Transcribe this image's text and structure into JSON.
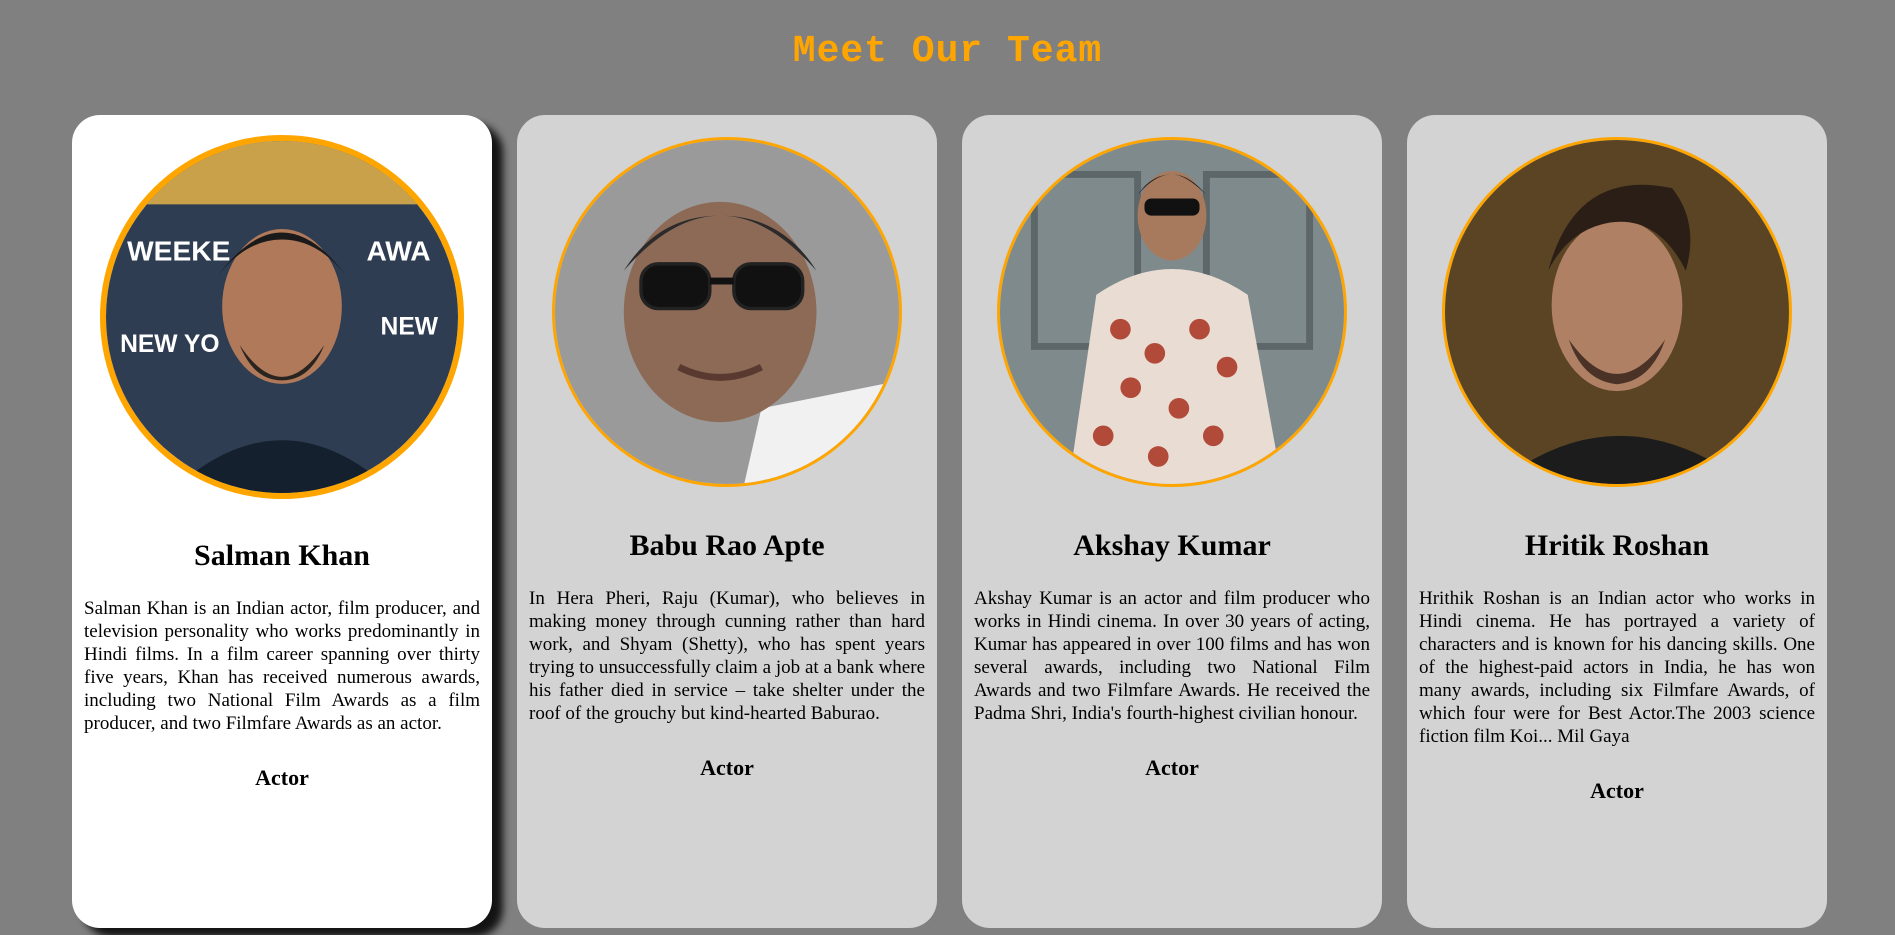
{
  "page": {
    "title": "Meet Our Team"
  },
  "colors": {
    "background": "#808080",
    "title": "#FFA500",
    "card": "#D3D3D3",
    "active_card": "#FFFFFF",
    "avatar_border": "#FFA500"
  },
  "team": [
    {
      "name": "Salman Khan",
      "bio": "Salman Khan is an Indian actor, film producer, and television personality who works predominantly in Hindi films. In a film career spanning over thirty five years, Khan has received numerous awards, including two National Film Awards as a film producer, and two Filmfare Awards as an actor.",
      "role": "Actor",
      "photo_icon": "person-photo",
      "state": "hovered"
    },
    {
      "name": "Babu Rao Apte",
      "bio": "In Hera Pheri, Raju (Kumar), who believes in making money through cunning rather than hard work, and Shyam (Shetty), who has spent years trying to unsuccessfully claim a job at a bank where his father died in service – take shelter under the roof of the grouchy but kind-hearted Baburao.",
      "role": "Actor",
      "photo_icon": "person-photo",
      "state": "default"
    },
    {
      "name": "Akshay Kumar",
      "bio": "Akshay Kumar is an actor and film producer who works in Hindi cinema. In over 30 years of acting, Kumar has appeared in over 100 films and has won several awards, including two National Film Awards and two Filmfare Awards. He received the Padma Shri, India's fourth-highest civilian honour.",
      "role": "Actor",
      "photo_icon": "person-photo",
      "state": "default"
    },
    {
      "name": "Hritik Roshan",
      "bio": "Hrithik Roshan is an Indian actor who works in Hindi cinema. He has portrayed a variety of characters and is known for his dancing skills. One of the highest-paid actors in India, he has won many awards, including six Filmfare Awards, of which four were for Best Actor.The 2003 science fiction film Koi... Mil Gaya",
      "role": "Actor",
      "photo_icon": "person-photo",
      "state": "default"
    }
  ]
}
